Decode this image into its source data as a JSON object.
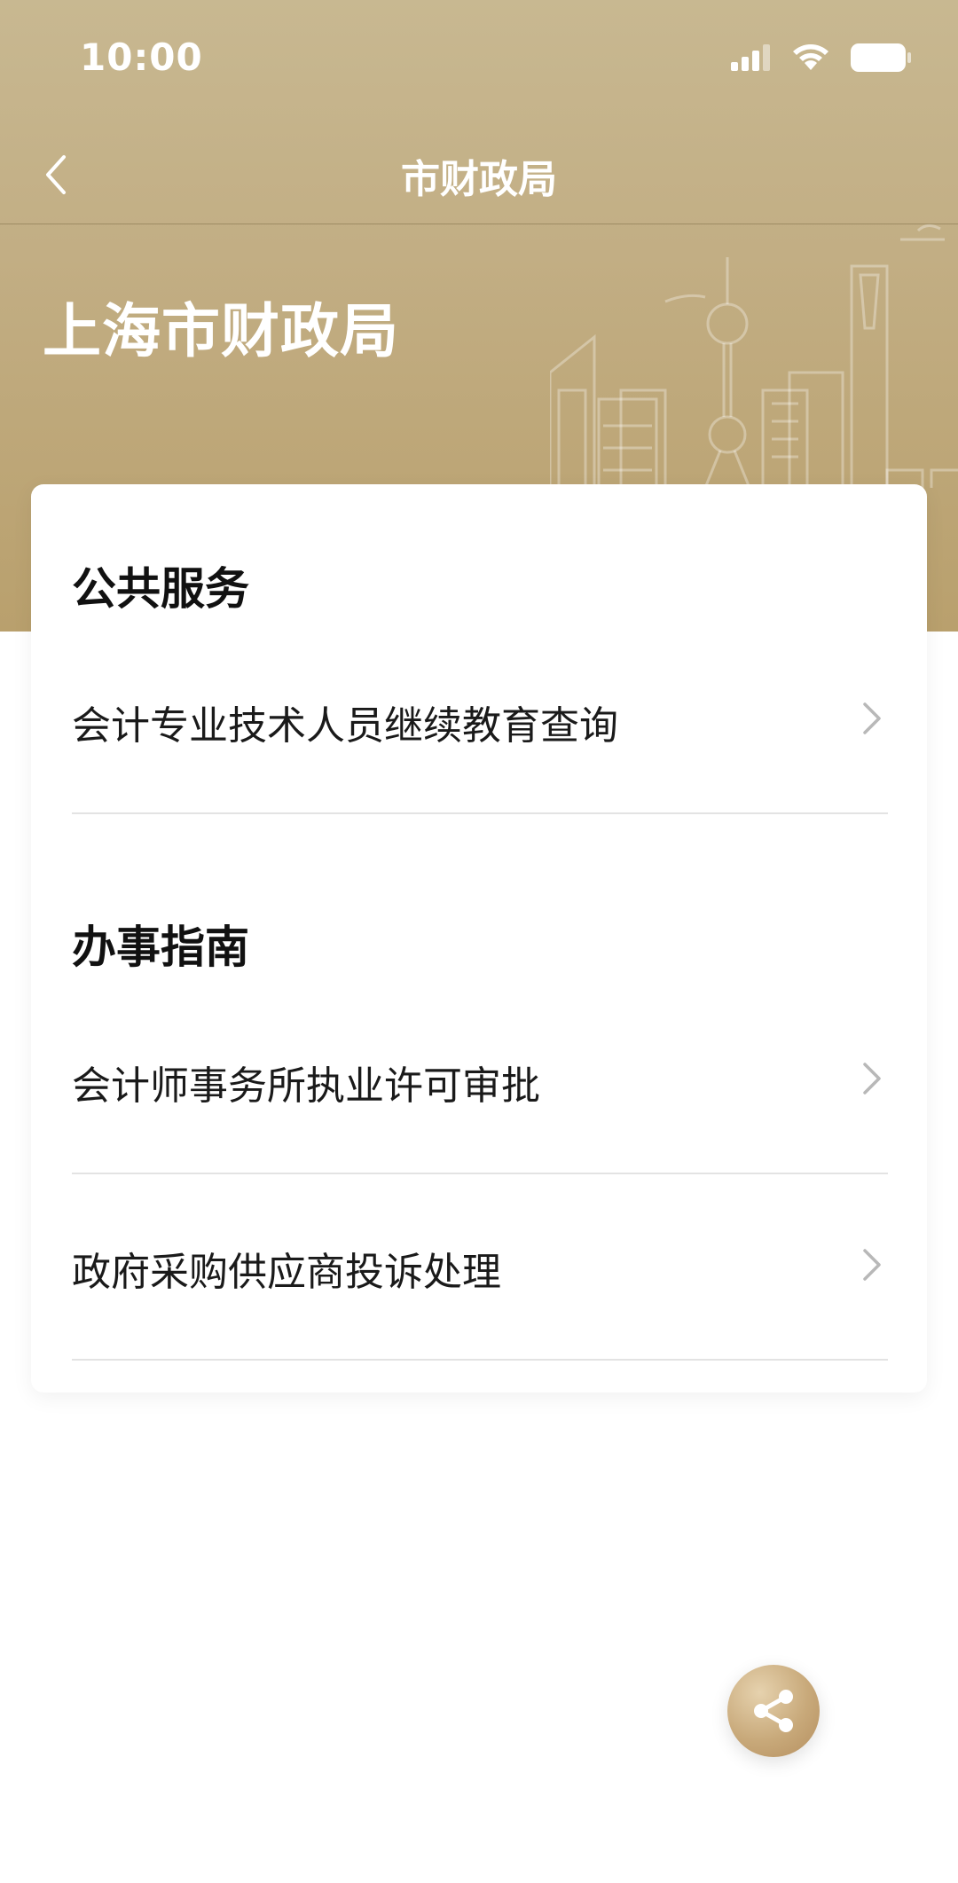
{
  "status_bar": {
    "time": "10:00"
  },
  "nav": {
    "title": "市财政局",
    "back_icon": "chevron-left-icon"
  },
  "hero": {
    "title": "上海市财政局"
  },
  "sections": [
    {
      "title": "公共服务",
      "items": [
        {
          "label": "会计专业技术人员继续教育查询"
        }
      ]
    },
    {
      "title": "办事指南",
      "items": [
        {
          "label": "会计师事务所执业许可审批"
        },
        {
          "label": "政府采购供应商投诉处理"
        }
      ]
    }
  ],
  "share": {
    "icon": "share-icon"
  },
  "colors": {
    "header_gold": "#c2ae84",
    "share_gold": "#c8a97a"
  }
}
